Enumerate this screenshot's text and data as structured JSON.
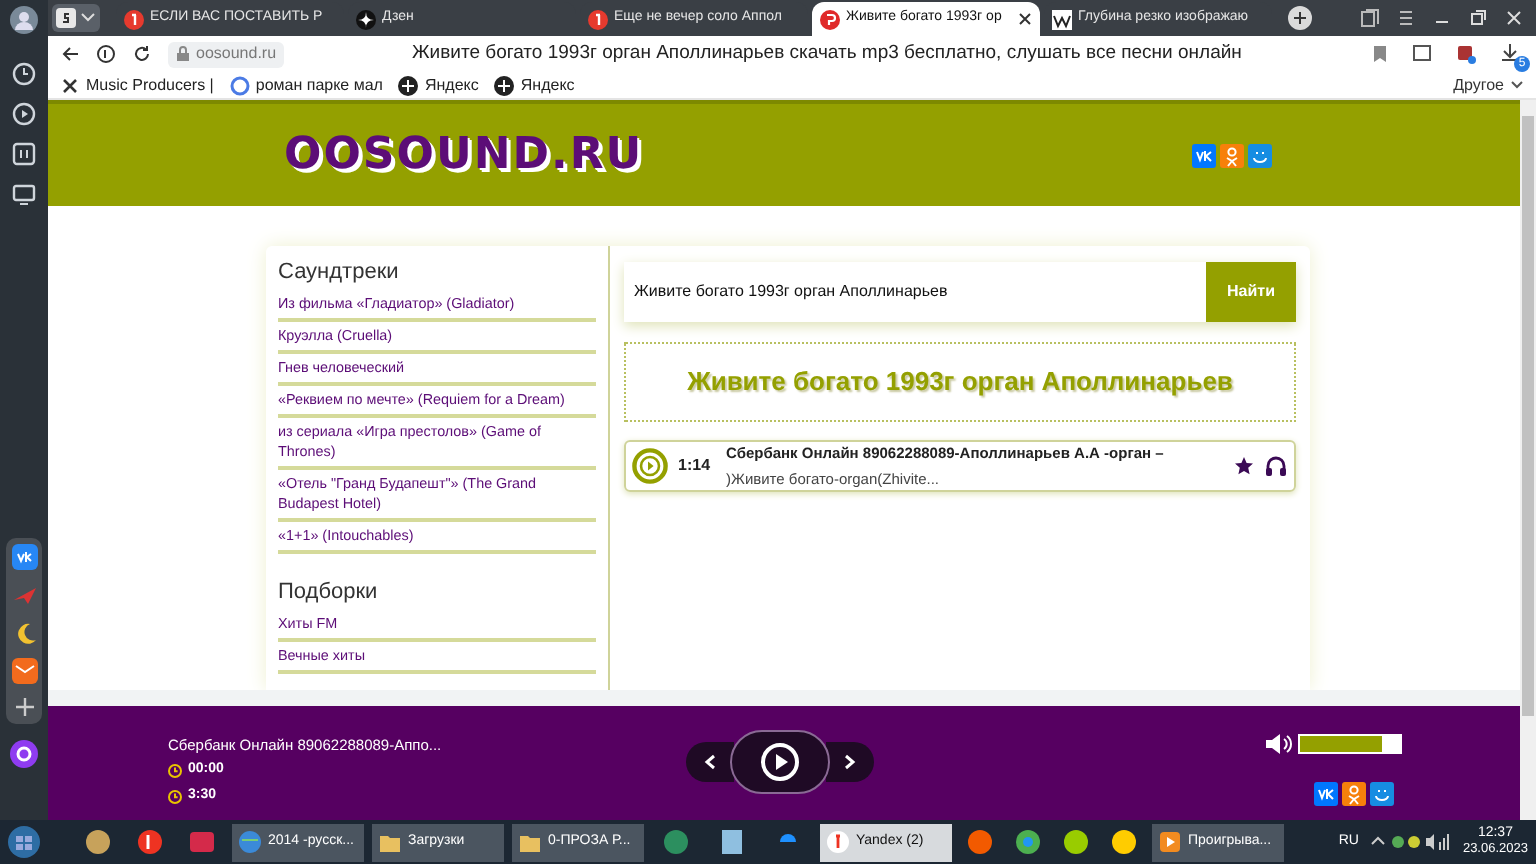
{
  "browser": {
    "tabs": [
      {
        "title": "ЕСЛИ ВАС ПОСТАВИТЬ Р",
        "selected": false
      },
      {
        "title": "Дзен",
        "selected": false
      },
      {
        "title": "Еще не вечер соло Аппол",
        "selected": false
      },
      {
        "title": "Живите богато 1993г ор",
        "selected": true
      },
      {
        "title": "Глубина резко изображаю",
        "selected": false
      }
    ],
    "address": "oosound.ru",
    "page_title": "Живите богато 1993г орган Аполлинарьев скачать mp3 бесплатно, слушать все песни онлайн",
    "bookmarks": [
      "Music Producers |",
      "роман парке мал",
      "Яндекс",
      "Яндекс"
    ],
    "other_bookmarks": "Другое",
    "download_count": "5"
  },
  "site": {
    "logo": "OOSOUND.RU",
    "sidebar": [
      {
        "title": "Саундтреки",
        "items": [
          "Из фильма «Гладиатор» (Gladiator)",
          "Круэлла (Cruella)",
          "Гнев человеческий",
          "«Реквием по мечте» (Requiem for a Dream)",
          "из сериала «Игра престолов» (Game of Thrones)",
          "«Отель \"Гранд Будапешт\"» (The Grand Budapest Hotel)",
          "«1+1» (Intouchables)"
        ]
      },
      {
        "title": "Подборки",
        "items": [
          "Хиты FM",
          "Вечные хиты"
        ]
      }
    ],
    "search": {
      "value": "Живите богато 1993г орган Аполлинарьев",
      "button": "Найти"
    },
    "heading": "Живите богато 1993г орган Аполлинарьев",
    "tracks": [
      {
        "duration": "1:14",
        "title": "Сбербанк Онлайн 89062288089-Аполлинарьев А.А -орган –",
        "subtitle": ")Живите богато-organ(Zhivite..."
      }
    ],
    "player": {
      "title": "Сбербанк Онлайн 89062288089-Аппо...",
      "elapsed": "00:00",
      "total": "3:30",
      "volume": {
        "level": 0.82
      }
    }
  },
  "taskbar": {
    "items": [
      {
        "label": "2014 -русск..."
      },
      {
        "label": "Загрузки"
      },
      {
        "label": "0-ПРОЗА Р..."
      },
      {
        "label": "Yandex (2)"
      },
      {
        "label": "Проигрыва..."
      }
    ],
    "language": "RU",
    "time": "12:37",
    "date": "23.06.2023"
  }
}
